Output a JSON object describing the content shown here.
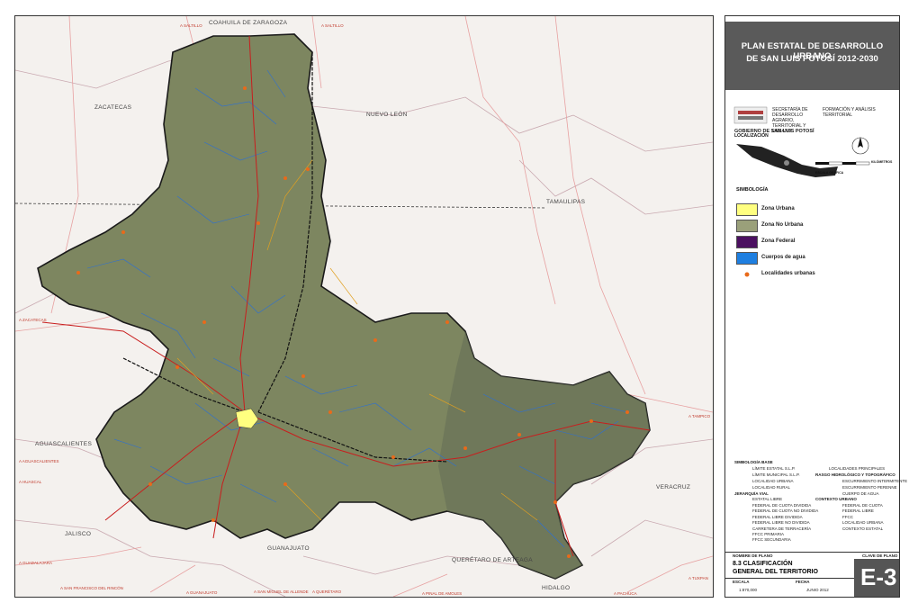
{
  "map": {
    "states": [
      "COAHUILA DE ZARAGOZA",
      "ZACATECAS",
      "NUEVO LEÓN",
      "TAMAULIPAS",
      "AGUASCALIENTES",
      "JALISCO",
      "GUANAJUATO",
      "QUERÉTARO DE ARTEAGA",
      "HIDALGO",
      "VERACRUZ"
    ],
    "road_destinations": [
      "A SALTILLO",
      "A SALTILLO",
      "A ZACATECAS",
      "A TAMPICO",
      "A AGUASCALIENTES",
      "A GUADALAJARA",
      "A SAN FRANCISCO DEL RINCÓN",
      "A GUANAJUATO",
      "A SAN MIGUEL DE ALLENDE",
      "A QUERÉTARO",
      "A PINAL DE AMOLES",
      "A PACHUCA",
      "A TUXPAN",
      "A HUASCAL"
    ],
    "trópico": "Trópico de Cáncer"
  },
  "panel": {
    "title_line1": "PLAN ESTATAL DE DESARROLLO URBANO",
    "title_line2": "DE SAN LUIS POTOSÍ  2012-2030",
    "gov": "GOBIERNO DE SAN LUIS POTOSÍ",
    "secretaria": "SECRETARÍA DE DESARROLLO AGRARIO, TERRITORIAL Y URBANO",
    "formacion": "FORMACIÓN Y ANÁLISIS TERRITORIAL",
    "ubicacion": "LOCALIZACIÓN",
    "escala_grafica": "ESCALA GRÁFICA",
    "km": "KILÓMETROS",
    "simbologia": "SIMBOLOGÍA",
    "legend": [
      {
        "label": "Zona Urbana",
        "color": "#ffff80"
      },
      {
        "label": "Zona No Urbana",
        "color": "#9aa07a"
      },
      {
        "label": "Zona Federal",
        "color": "#4b1060"
      },
      {
        "label": "Cuerpos de agua",
        "color": "#1f7fe0"
      }
    ],
    "localidades_urbanas": "Localidades urbanas",
    "simbologia_base": "SIMBOLOGÍA BASE",
    "base_left": [
      "LÍMITE ESTATAL S.L.P.",
      "LÍMITE MUNICIPAL S.L.P.",
      "LOCALIDAD URBANA",
      "LOCALIDAD RURAL",
      "JERARQUÍA VIAL",
      "ESTATAL LIBRE",
      "FEDERAL DE CUOTA DIVIDIDA",
      "FEDERAL DE CUOTA NO DIVIDIDA",
      "FEDERAL LIBRE DIVIDIDA",
      "FEDERAL LIBRE NO DIVIDIDA",
      "CARRETERA DE TERRACERÍA",
      "FFCC PRIMARIA",
      "FFCC SECUNDARIA"
    ],
    "base_right": [
      "LOCALIDADES PRINCIPALES",
      "RASGO HIDROLÓGICO Y TOPOGRÁFICO",
      "ESCURRIMIENTO INTERMITENTE",
      "ESCURRIMIENTO PERENNE",
      "CUERPO DE AGUA",
      "CONTEXTO URBANO",
      "FEDERAL DE CUOTA",
      "FEDERAL LIBRE",
      "FFCC",
      "LOCALIDAD URBANA",
      "CONTEXTO ESTATAL"
    ],
    "nombre_plano_label": "NOMBRE DE PLANO",
    "clave_label": "CLAVE DE PLANO",
    "nombre_plano_1": "8.3 CLASIFICACIÓN",
    "nombre_plano_2": "GENERAL DEL TERRITORIO",
    "escala_label": "ESCALA",
    "escala": "1:870,000",
    "fecha_label": "FECHA",
    "fecha": "JUNIO 2012",
    "clave": "E-3"
  },
  "colors": {
    "state_fill": "#7d8660",
    "river": "#2b6fd6",
    "road_red": "#c81e1e",
    "road_orange": "#e0a020",
    "header_bg": "#5a5a5a"
  }
}
